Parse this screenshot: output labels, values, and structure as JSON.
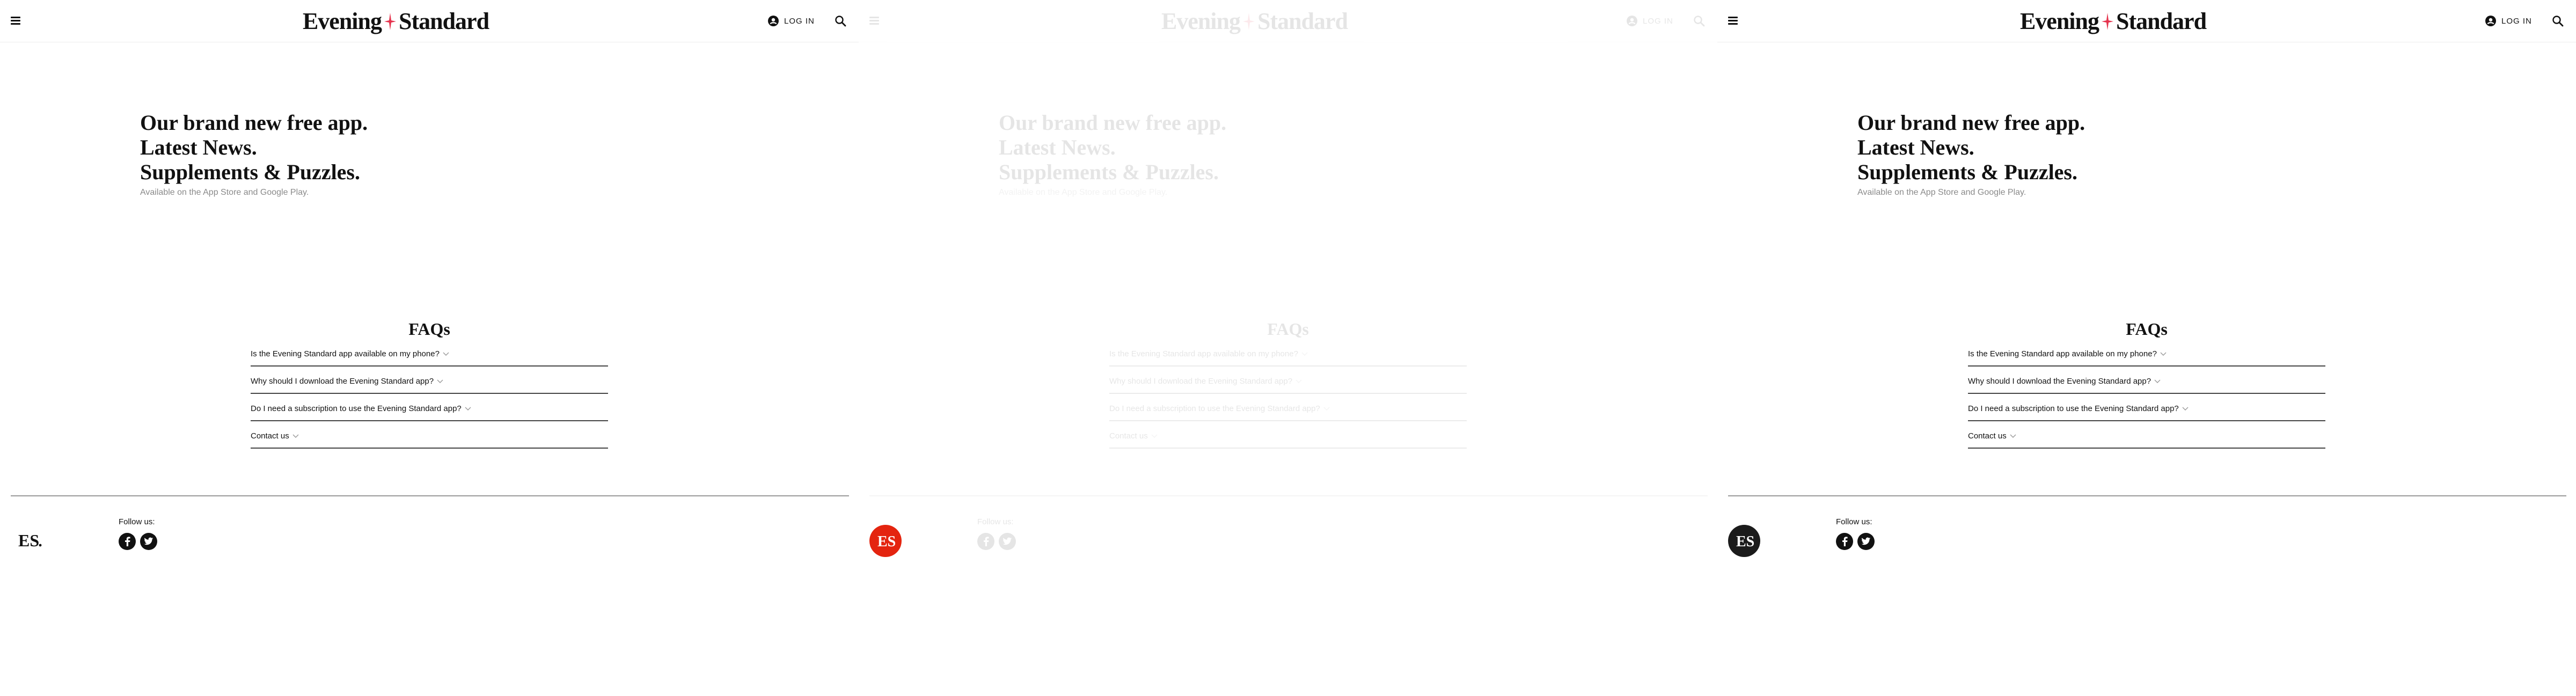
{
  "header": {
    "logo_left": "Evening",
    "logo_right": "Standard",
    "login_label": "LOG IN"
  },
  "promo": {
    "lines": [
      "Our brand new free app.",
      "Latest News.",
      "Supplements & Puzzles."
    ],
    "subtitle": "Available on the App Store and Google Play."
  },
  "faqs": {
    "title": "FAQs",
    "items": [
      "Is the Evening Standard app available on my phone?",
      "Why should I download the Evening Standard app?",
      "Do I need a subscription to use the Evening Standard app?",
      "Contact us"
    ]
  },
  "footer": {
    "logo_text": "ES",
    "follow_label": "Follow us:",
    "socials": [
      "facebook-icon",
      "twitter-icon"
    ]
  },
  "theme": {
    "logo_accent": "#e5334d",
    "footer_logo_colors": [
      "#111111",
      "#e4240f",
      "#1b1b1b"
    ],
    "chevron_color": "#999999"
  }
}
